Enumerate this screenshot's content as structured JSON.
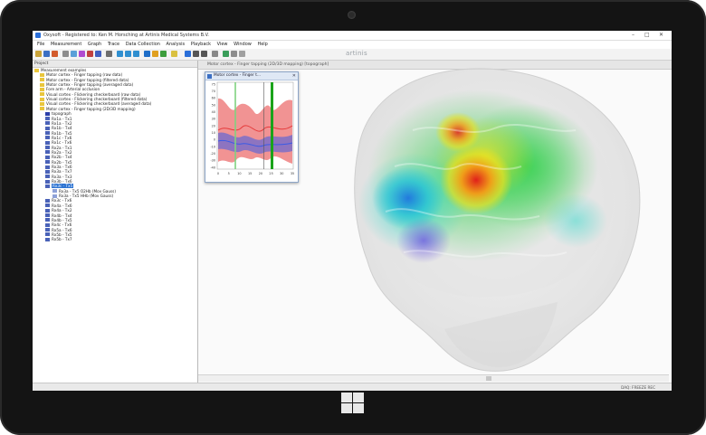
{
  "window": {
    "title": "Oxysoft - Registered to: Ken M. Horsching at Artinis Medical Systems B.V.",
    "controls": [
      "–",
      "□",
      "✕"
    ]
  },
  "menu": [
    "File",
    "Measurement",
    "Graph",
    "Trace",
    "Data Collection",
    "Analysis",
    "Playback",
    "View",
    "Window",
    "Help"
  ],
  "toolbar": {
    "brand": "artinis"
  },
  "project_panel": {
    "title": "Project",
    "root": "Measurement examples",
    "folders": [
      "Motor cortex - Finger tapping (raw data)",
      "Motor cortex - Finger tapping (filtered data)",
      "Motor cortex - Finger tapping (averaged data)",
      "Fore arm - Arterial occlusion",
      "Visual cortex - Flickering checkerboard (raw data)",
      "Visual cortex - Flickering checkerboard (filtered data)",
      "Visual cortex - Flickering checkerboard (averaged data)",
      "Motor cortex - Finger tapping (2D/3D mapping)"
    ],
    "topograph": "topograph",
    "channels_a": [
      "Rx1a - Tx1",
      "Rx1a - Tx2",
      "Rx1b - Tx4",
      "Rx1b - Tx5",
      "Rx1c - Tx6",
      "Rx1c - Tx6",
      "Rx2a - Tx1",
      "Rx2a - Tx2",
      "Rx2b - Tx4",
      "Rx2b - Tx5",
      "Rx3a - Tx6",
      "Rx3a - Tx7",
      "Rx3a - Tx3",
      "Rx3b - Tx6"
    ],
    "selected": "Rx3c - Tx5",
    "subitems": [
      "Rx3a - Tx5 O2Hb (Mov Gauss)",
      "Rx3a - Tx5 HHb (Mov Gauss)"
    ],
    "channels_b": [
      "Rx3c - Tx6",
      "Rx4a - Tx6",
      "Rx4a - Tx2",
      "Rx4b - Tx4",
      "Rx4b - Tx5",
      "Rx4c - Tx6",
      "Rx5a - Tx6",
      "Rx5b - Tx5",
      "Rx5b - Tx7"
    ]
  },
  "document": {
    "title": "Motor cortex - Finger tapping (2D/3D mapping) [topograph]"
  },
  "graph_window": {
    "title": "Motor cortex - Finger t...",
    "y_ticks": [
      "75",
      "70",
      "60",
      "50",
      "40",
      "30",
      "20",
      "10",
      "0",
      "-10",
      "-20",
      "-30",
      "-40"
    ],
    "x_ticks": [
      "0",
      "5",
      "10",
      "15",
      "20",
      "25",
      "30",
      "35"
    ],
    "colors": {
      "o2hb": "#e53a3a",
      "hhb": "#3a5be5",
      "marker": "#1aa31a"
    }
  },
  "status": {
    "text": "DAQ: FREEZE REC"
  },
  "colors": {
    "selection": "#2c73d2",
    "titlebar_icon": "#2a6ed8"
  }
}
